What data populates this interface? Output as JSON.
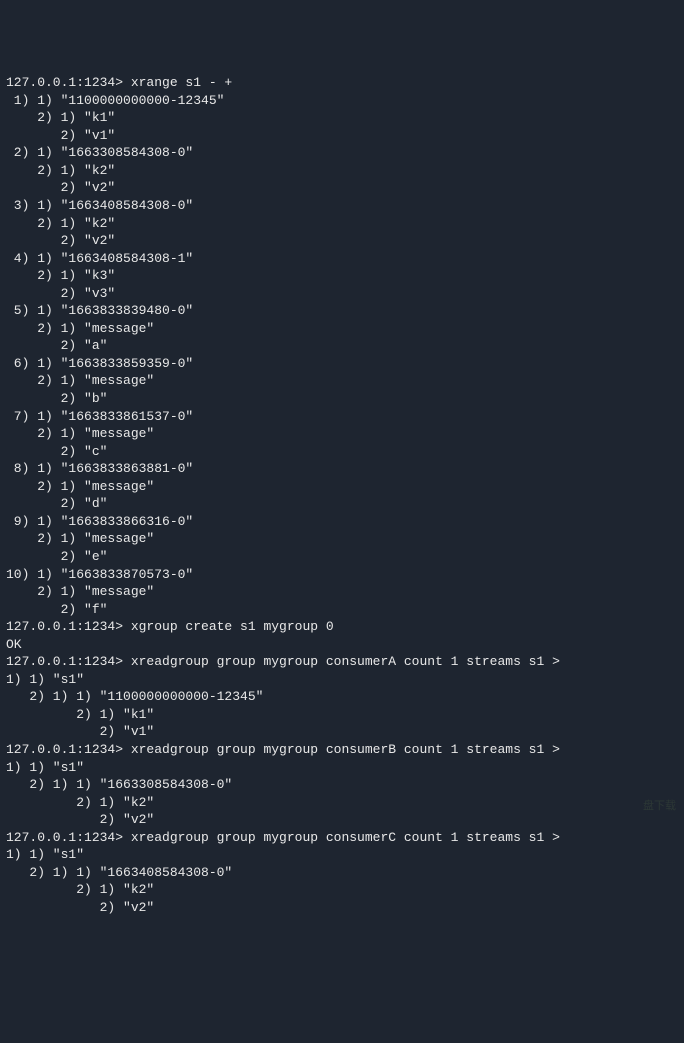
{
  "prompt": "127.0.0.1:1234>",
  "commands": {
    "xrange": "xrange s1 - +",
    "xgroup": "xgroup create s1 mygroup 0",
    "xreadA": "xreadgroup group mygroup consumerA count 1 streams s1 >",
    "xreadB": "xreadgroup group mygroup consumerB count 1 streams s1 >",
    "xreadC": "xreadgroup group mygroup consumerC count 1 streams s1 >"
  },
  "xrange_entries": [
    {
      "idx": " 1",
      "id": "1100000000000-12345",
      "fields": [
        [
          "k1",
          "v1"
        ]
      ]
    },
    {
      "idx": " 2",
      "id": "1663308584308-0",
      "fields": [
        [
          "k2",
          "v2"
        ]
      ]
    },
    {
      "idx": " 3",
      "id": "1663408584308-0",
      "fields": [
        [
          "k2",
          "v2"
        ]
      ]
    },
    {
      "idx": " 4",
      "id": "1663408584308-1",
      "fields": [
        [
          "k3",
          "v3"
        ]
      ]
    },
    {
      "idx": " 5",
      "id": "1663833839480-0",
      "fields": [
        [
          "message",
          "a"
        ]
      ]
    },
    {
      "idx": " 6",
      "id": "1663833859359-0",
      "fields": [
        [
          "message",
          "b"
        ]
      ]
    },
    {
      "idx": " 7",
      "id": "1663833861537-0",
      "fields": [
        [
          "message",
          "c"
        ]
      ]
    },
    {
      "idx": " 8",
      "id": "1663833863881-0",
      "fields": [
        [
          "message",
          "d"
        ]
      ]
    },
    {
      "idx": " 9",
      "id": "1663833866316-0",
      "fields": [
        [
          "message",
          "e"
        ]
      ]
    },
    {
      "idx": "10",
      "id": "1663833870573-0",
      "fields": [
        [
          "message",
          "f"
        ]
      ]
    }
  ],
  "xgroup_result": "OK",
  "xread_results": {
    "A": {
      "stream": "s1",
      "id": "1100000000000-12345",
      "fields": [
        [
          "k1",
          "v1"
        ]
      ]
    },
    "B": {
      "stream": "s1",
      "id": "1663308584308-0",
      "fields": [
        [
          "k2",
          "v2"
        ]
      ]
    },
    "C": {
      "stream": "s1",
      "id": "1663408584308-0",
      "fields": [
        [
          "k2",
          "v2"
        ]
      ]
    }
  },
  "watermark": "盘下载"
}
